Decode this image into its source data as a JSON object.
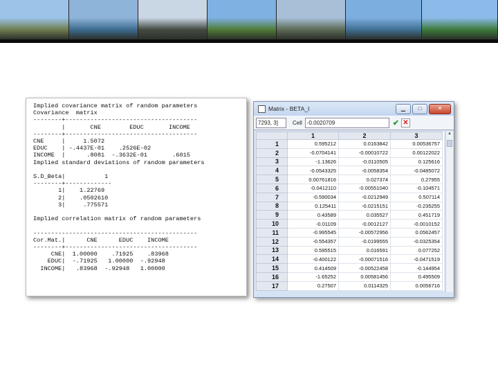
{
  "banner": {
    "tiles": [
      {
        "name": "lugano-hilltown",
        "sky": "#9cc3e8",
        "land": "#6f7d4f"
      },
      {
        "name": "lake-bay",
        "sky": "#8fb4d9",
        "land": "#3d6b8f"
      },
      {
        "name": "lakeside-promenade",
        "sky": "#c9d6e4",
        "land": "#444a42"
      },
      {
        "name": "garden-monte",
        "sky": "#7fb1e3",
        "land": "#4f7b37"
      },
      {
        "name": "lake-aerial",
        "sky": "#a7c0d8",
        "land": "#5c6a55"
      },
      {
        "name": "mountain-lake",
        "sky": "#7daee0",
        "land": "#3f6f93"
      },
      {
        "name": "waterfront-walk",
        "sky": "#8cbbe9",
        "land": "#3d7a3a"
      }
    ]
  },
  "output": {
    "lines": [
      "Implied covariance matrix of random parameters",
      "Covariance  matrix",
      "--------+-------------------------------------",
      "        |       CNE        EDUC       INCOME",
      "--------+-------------------------------------",
      "CNE     |     1.5072",
      "EDUC    | -.4437E-01    .2526E-02",
      "INCOME  |      .8081  -.3632E-01       .6015",
      "Implied standard deviations of random parameters",
      "",
      "S.D_Beta|           1",
      "--------+-------------",
      "       1|    1.22769",
      "       2|    .0502610",
      "       3|     .775571",
      "",
      "Implied correlation matrix of random parameters",
      "",
      "----------------------------------------------",
      "Cor.Mat.|      CNE      EDUC    INCOME",
      "--------+-------------------------------------",
      "     CNE|  1.00000    .71925    .83968",
      "    EDUC|  -.71925   1.00000  -.92948",
      "  INCOME|   .83968  -.92948   1.00000"
    ]
  },
  "matrix_window": {
    "title": "Matrix - BETA_I",
    "cell_ref": "7293, 3]",
    "cell_label": "Cell",
    "cell_value": "-0.0020709",
    "buttons": {
      "minimize": "▁",
      "maximize": "□",
      "close": "✕"
    },
    "columns": [
      "1",
      "2",
      "3"
    ],
    "rows": [
      {
        "i": "1",
        "v": [
          "0.595212",
          "0.0163842",
          "0.00536757"
        ]
      },
      {
        "i": "2",
        "v": [
          "-0.0704141",
          "-0.00010722",
          "0.00122022"
        ]
      },
      {
        "i": "3",
        "v": [
          "-1.13626",
          "-0.0110505",
          "0.125616"
        ]
      },
      {
        "i": "4",
        "v": [
          "-0.0543325",
          "-0.0058354",
          "-0.0485072"
        ]
      },
      {
        "i": "5",
        "v": [
          "0.00761816",
          "0.027374",
          "0.27955"
        ]
      },
      {
        "i": "6",
        "v": [
          "-0.0412110",
          "-0.00551040",
          "-0.104571"
        ]
      },
      {
        "i": "7",
        "v": [
          "-0.590034",
          "-0.0212949",
          "0.507114"
        ]
      },
      {
        "i": "8",
        "v": [
          "0.125411",
          "-0.0215151",
          "-0.235255"
        ]
      },
      {
        "i": "9",
        "v": [
          "0.43589",
          "0.035527",
          "0.451719"
        ]
      },
      {
        "i": "10",
        "v": [
          "-0.01109",
          "-0.0012127",
          "-0.0010152"
        ]
      },
      {
        "i": "11",
        "v": [
          "-0.995545",
          "-0.00572956",
          "0.0562457"
        ]
      },
      {
        "i": "12",
        "v": [
          "-0.554357",
          "-0.0199555",
          "-0.0325354"
        ]
      },
      {
        "i": "13",
        "v": [
          "0.595515",
          "0.016591",
          "0.077252"
        ]
      },
      {
        "i": "14",
        "v": [
          "-0.400122",
          "-0.00071516",
          "-0.0471519"
        ]
      },
      {
        "i": "15",
        "v": [
          "0.414509",
          "-0.00522458",
          "-0.144954"
        ]
      },
      {
        "i": "16",
        "v": [
          "-1.65252",
          "0.00581456",
          "0.495509"
        ]
      },
      {
        "i": "17",
        "v": [
          "0.27507",
          "0.0114325",
          "0.0056716"
        ]
      }
    ]
  }
}
